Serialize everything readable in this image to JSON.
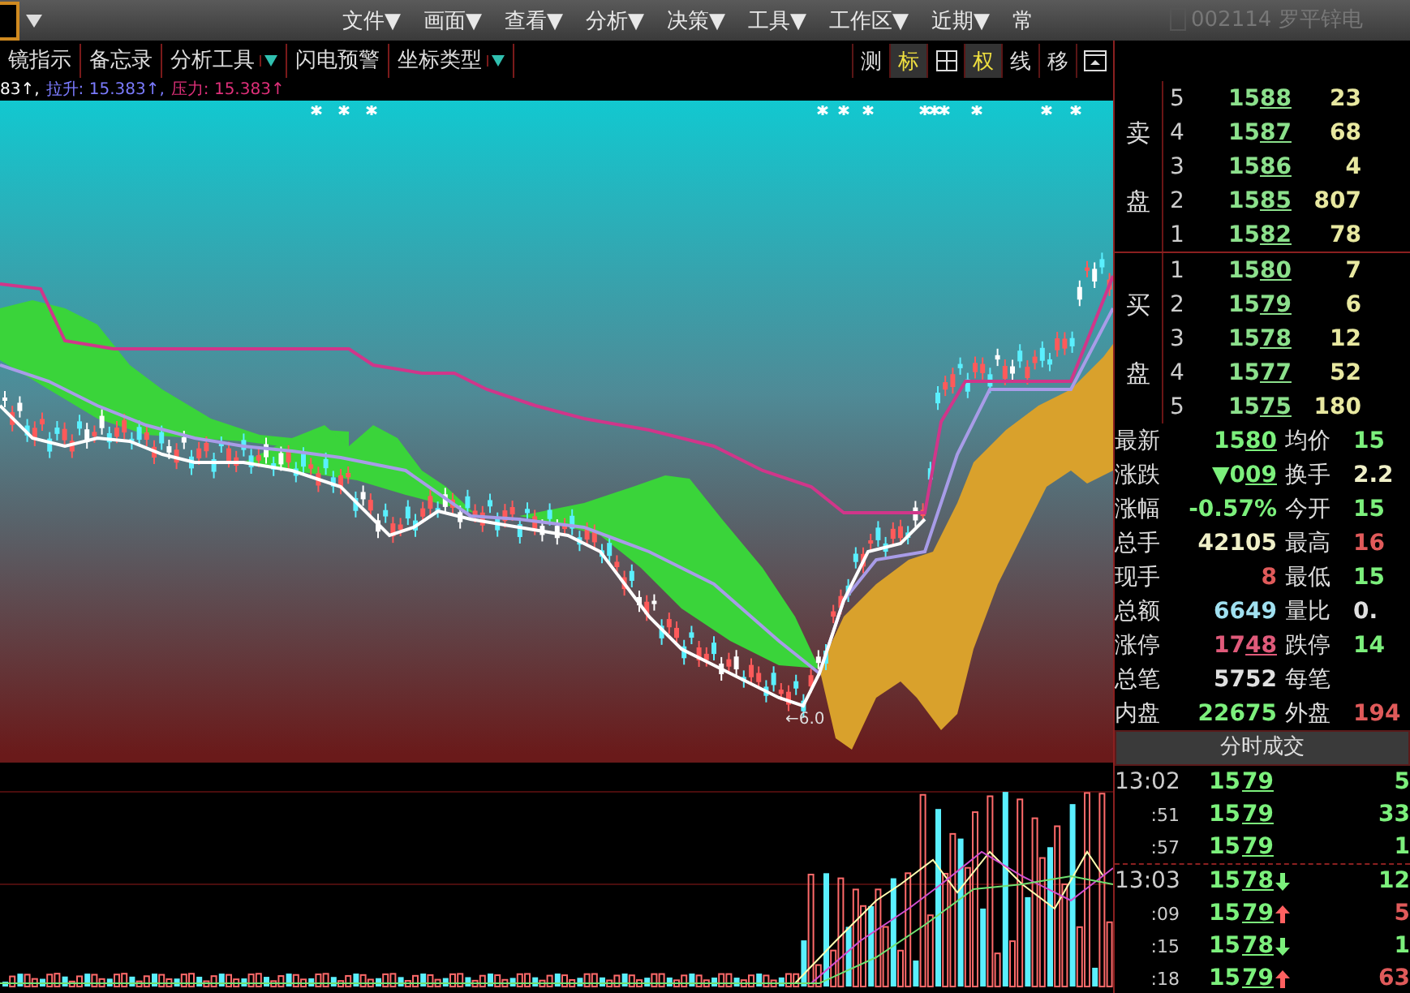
{
  "menu_bar": {
    "items": [
      "文件▼",
      "画面▼",
      "查看▼",
      "分析▼",
      "决策▼",
      "工具▼",
      "工作区▼",
      "近期▼",
      "常"
    ]
  },
  "toolbar": {
    "left": [
      {
        "label": "镜指示",
        "dropdown": false
      },
      {
        "label": "备忘录",
        "dropdown": false
      },
      {
        "label": "分析工具",
        "dropdown": true
      },
      {
        "label": "闪电预警",
        "dropdown": false
      },
      {
        "label": "坐标类型",
        "dropdown": true
      }
    ],
    "right": [
      {
        "kind": "text",
        "label": "测",
        "selected": false
      },
      {
        "kind": "text",
        "label": "标",
        "selected": true
      },
      {
        "kind": "grid",
        "selected": false
      },
      {
        "kind": "text",
        "label": "权",
        "selected": true
      },
      {
        "kind": "text",
        "label": "线",
        "selected": false
      },
      {
        "kind": "text",
        "label": "移",
        "selected": false
      },
      {
        "kind": "window",
        "selected": false
      }
    ],
    "stock": "002114 罗平锌电"
  },
  "indicator_line": [
    {
      "text": "83↑,",
      "color": "#ffffff"
    },
    {
      "text": "拉升: 15.383↑,",
      "color": "#7b7bff"
    },
    {
      "text": "压力: 15.383↑",
      "color": "#e0307a"
    }
  ],
  "price_chart": {
    "marker_label": "←6.0"
  },
  "order_book": {
    "sell_label": "卖盘",
    "buy_label": "买盘",
    "sell": [
      {
        "rank": "5",
        "price": "1588",
        "volume": "23"
      },
      {
        "rank": "4",
        "price": "1587",
        "volume": "68"
      },
      {
        "rank": "3",
        "price": "1586",
        "volume": "4"
      },
      {
        "rank": "2",
        "price": "1585",
        "volume": "807"
      },
      {
        "rank": "1",
        "price": "1582",
        "volume": "78"
      }
    ],
    "buy": [
      {
        "rank": "1",
        "price": "1580",
        "volume": "7"
      },
      {
        "rank": "2",
        "price": "1579",
        "volume": "6"
      },
      {
        "rank": "3",
        "price": "1578",
        "volume": "12"
      },
      {
        "rank": "4",
        "price": "1577",
        "volume": "52"
      },
      {
        "rank": "5",
        "price": "1575",
        "volume": "180"
      }
    ]
  },
  "stats": [
    {
      "left": {
        "label": "最新",
        "value": "1580",
        "color": "#7cf07c",
        "underline": true
      },
      "right": {
        "label": "均价",
        "value": "15",
        "color": "#7cf07c"
      }
    },
    {
      "left": {
        "label": "涨跌",
        "value": "▼009",
        "color": "#7cf07c",
        "underline": true
      },
      "right": {
        "label": "换手",
        "value": "2.2",
        "color": "#f0f0c8"
      }
    },
    {
      "left": {
        "label": "涨幅",
        "value": "-0.57%",
        "color": "#7cf07c",
        "underline": false
      },
      "right": {
        "label": "今开",
        "value": "15",
        "color": "#7cf07c"
      }
    },
    {
      "left": {
        "label": "总手",
        "value": "42105",
        "color": "#f0f0c8",
        "underline": false
      },
      "right": {
        "label": "最高",
        "value": "16",
        "color": "#e05a5a"
      }
    },
    {
      "left": {
        "label": "现手",
        "value": "8",
        "color": "#e05a5a",
        "underline": false
      },
      "right": {
        "label": "最低",
        "value": "15",
        "color": "#7cf07c"
      }
    },
    {
      "left": {
        "label": "总额",
        "value": "6649",
        "color": "#a0e0f0",
        "underline": false
      },
      "right": {
        "label": "量比",
        "value": "0.",
        "color": "#e0e0e0"
      }
    },
    {
      "left": {
        "label": "涨停",
        "value": "1748",
        "color": "#e05a7a",
        "underline": true
      },
      "right": {
        "label": "跌停",
        "value": "14",
        "color": "#7cf07c"
      }
    },
    {
      "left": {
        "label": "总笔",
        "value": "5752",
        "color": "#e0e0e0",
        "underline": false
      },
      "right": {
        "label": "每笔"
      }
    },
    {
      "left": {
        "label": "内盘",
        "value": "22675",
        "color": "#7cf07c",
        "underline": false
      },
      "right": {
        "label": "外盘",
        "value": "194",
        "color": "#e05a5a"
      }
    }
  ],
  "ticks_header": "分时成交",
  "ticks": [
    {
      "kind": "minute",
      "time": "13:02",
      "price": "1579",
      "rising": false,
      "falling": false,
      "volume": "5",
      "color": "#7cf07c"
    },
    {
      "kind": "second",
      "time": ":51",
      "price": "1579",
      "rising": false,
      "falling": false,
      "volume": "33",
      "color": "#7cf07c"
    },
    {
      "kind": "second",
      "time": ":57",
      "price": "1579",
      "rising": false,
      "falling": false,
      "volume": "1",
      "color": "#7cf07c"
    },
    {
      "kind": "minute",
      "time": "13:03",
      "price": "1578",
      "rising": false,
      "falling": true,
      "volume": "12",
      "color": "#7cf07c"
    },
    {
      "kind": "second",
      "time": ":09",
      "price": "1579",
      "rising": true,
      "falling": false,
      "volume": "5",
      "color": "#e05a5a"
    },
    {
      "kind": "second",
      "time": ":15",
      "price": "1578",
      "rising": false,
      "falling": true,
      "volume": "1",
      "color": "#7cf07c"
    },
    {
      "kind": "second",
      "time": ":18",
      "price": "1579",
      "rising": true,
      "falling": false,
      "volume": "63",
      "color": "#e05a5a"
    }
  ]
}
